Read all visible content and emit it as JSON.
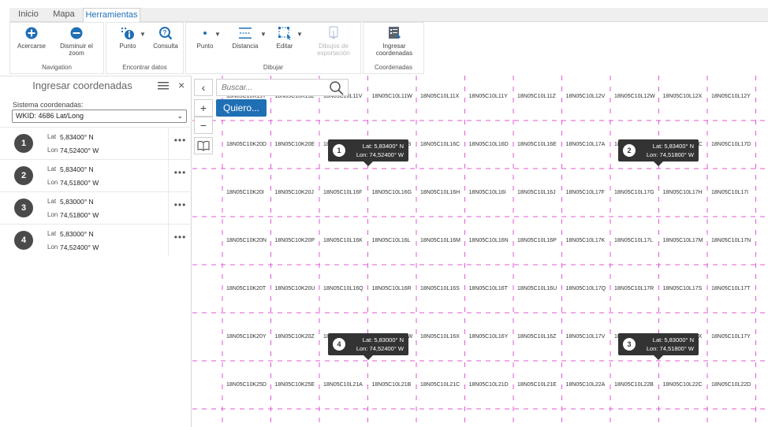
{
  "tabs": [
    {
      "label": "Inicio",
      "active": false
    },
    {
      "label": "Mapa",
      "active": false
    },
    {
      "label": "Herramientas",
      "active": true
    }
  ],
  "ribbon": {
    "groups": [
      {
        "title": "Navigation",
        "buttons": [
          {
            "label": "Acercarse",
            "icon": "zoom-in-icon"
          },
          {
            "label": "Disminuir el zoom",
            "icon": "zoom-out-icon"
          }
        ]
      },
      {
        "title": "Encontrar datos",
        "buttons": [
          {
            "label": "Punto",
            "icon": "info-point-icon"
          },
          {
            "label": "Consulta",
            "icon": "query-icon"
          }
        ]
      },
      {
        "title": "Dibujar",
        "buttons": [
          {
            "label": "Punto",
            "icon": "point-icon"
          },
          {
            "label": "Distancia",
            "icon": "distance-icon"
          },
          {
            "label": "Editar",
            "icon": "edit-icon"
          },
          {
            "label": "Dibujos de exportación",
            "icon": "export-drawings-icon",
            "disabled": true
          }
        ]
      },
      {
        "title": "Coordenadas",
        "buttons": [
          {
            "label": "Ingresar coordenadas",
            "icon": "enter-coordinates-icon"
          }
        ]
      }
    ]
  },
  "panel": {
    "title": "Ingresar coordenadas",
    "system_label": "Sistema coordenadas:",
    "system_value": "WKID: 4686 Lat/Long",
    "lat_label": "Lat",
    "lon_label": "Lon",
    "more": "•••",
    "coordinates": [
      {
        "num": "1",
        "lat": "5,83400° N",
        "lon": "74,52400° W"
      },
      {
        "num": "2",
        "lat": "5,83400° N",
        "lon": "74,51800° W"
      },
      {
        "num": "3",
        "lat": "5,83000° N",
        "lon": "74,51800° W"
      },
      {
        "num": "4",
        "lat": "5,83000° N",
        "lon": "74,52400° W"
      }
    ]
  },
  "map": {
    "search_placeholder": "Buscar...",
    "quiero_label": "Quiero...",
    "zoom_in": "+",
    "zoom_out": "−",
    "back": "‹",
    "grid_color": "#e05ad6",
    "accent": "#1f6fb5",
    "rows": [
      [
        "18N05C10K19T",
        "18N05C10K19Z",
        "18N05C10L11V",
        "18N05C10L11W",
        "18N05C10L11X",
        "18N05C10L11Y",
        "18N05C10L11Z",
        "18N05C10L12V",
        "18N05C10L12W",
        "18N05C10L12X",
        "18N05C10L12Y"
      ],
      [
        "18N05C10K20D",
        "18N05C10K20E",
        "18N05C10L16A",
        "18N05C10L16B",
        "18N05C10L16C",
        "18N05C10L16D",
        "18N05C10L16E",
        "18N05C10L17A",
        "18N05C10L17B",
        "18N05C10L17C",
        "18N05C10L17D"
      ],
      [
        "18N05C10K20I",
        "18N05C10K20J",
        "18N05C10L16F",
        "18N05C10L16G",
        "18N05C10L16H",
        "18N05C10L16I",
        "18N05C10L16J",
        "18N05C10L17F",
        "18N05C10L17G",
        "18N05C10L17H",
        "18N05C10L17I"
      ],
      [
        "18N05C10K20N",
        "18N05C10K20P",
        "18N05C10L16K",
        "18N05C10L16L",
        "18N05C10L16M",
        "18N05C10L16N",
        "18N05C10L16P",
        "18N05C10L17K",
        "18N05C10L17L",
        "18N05C10L17M",
        "18N05C10L17N"
      ],
      [
        "18N05C10K20T",
        "18N05C10K20U",
        "18N05C10L16Q",
        "18N05C10L16R",
        "18N05C10L16S",
        "18N05C10L16T",
        "18N05C10L16U",
        "18N05C10L17Q",
        "18N05C10L17R",
        "18N05C10L17S",
        "18N05C10L17T"
      ],
      [
        "18N05C10K20Y",
        "18N05C10K20Z",
        "18N05C10L16V",
        "18N05C10L16W",
        "18N05C10L16X",
        "18N05C10L16Y",
        "18N05C10L16Z",
        "18N05C10L17V",
        "18N05C10L17W",
        "18N05C10L17X",
        "18N05C10L17Y"
      ],
      [
        "18N05C10K25D",
        "18N05C10K25E",
        "18N05C10L21A",
        "18N05C10L21B",
        "18N05C10L21C",
        "18N05C10L21D",
        "18N05C10L21E",
        "18N05C10L22A",
        "18N05C10L22B",
        "18N05C10L22C",
        "18N05C10L22D"
      ]
    ],
    "pins": [
      {
        "num": "1",
        "lat": "Lat: 5,83400° N",
        "lon": "Lon: 74,52400° W"
      },
      {
        "num": "2",
        "lat": "Lat: 5,83400° N",
        "lon": "Lon: 74,51800° W"
      },
      {
        "num": "3",
        "lat": "Lat: 5,83000° N",
        "lon": "Lon: 74,51800° W"
      },
      {
        "num": "4",
        "lat": "Lat: 5,83000° N",
        "lon": "Lon: 74,52400° W"
      }
    ]
  }
}
